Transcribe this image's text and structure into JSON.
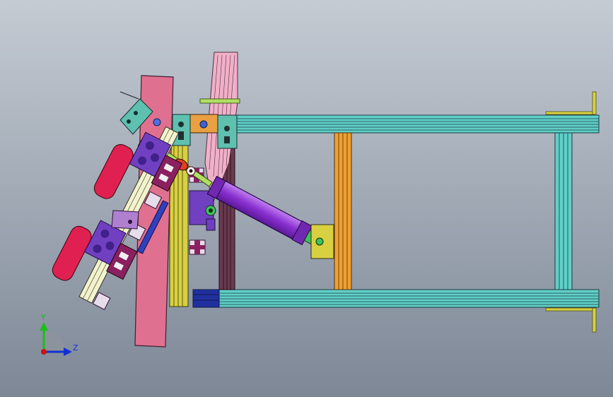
{
  "viewport": {
    "background_top": "#c4cbd3",
    "background_bottom": "#7d8796"
  },
  "triad": {
    "y_label": "Y",
    "z_label": "Z",
    "y_color": "#18c018",
    "z_color": "#1030d8",
    "origin_color": "#d01010"
  },
  "parts": {
    "frame_rail_color": "#60d0c8",
    "upright_color": "#f0a030",
    "plate_color": "#e07090",
    "post_color": "#f0b0c8",
    "cylinder_color": "#9040d0",
    "rod_color": "#b0e060",
    "mount_color": "#7040c0",
    "gripper_color": "#8a2060",
    "pad_color": "#e02050",
    "bracket_color": "#60c0b0",
    "yellow_beam_color": "#d8d040",
    "dark_post_color": "#6a3a50"
  }
}
